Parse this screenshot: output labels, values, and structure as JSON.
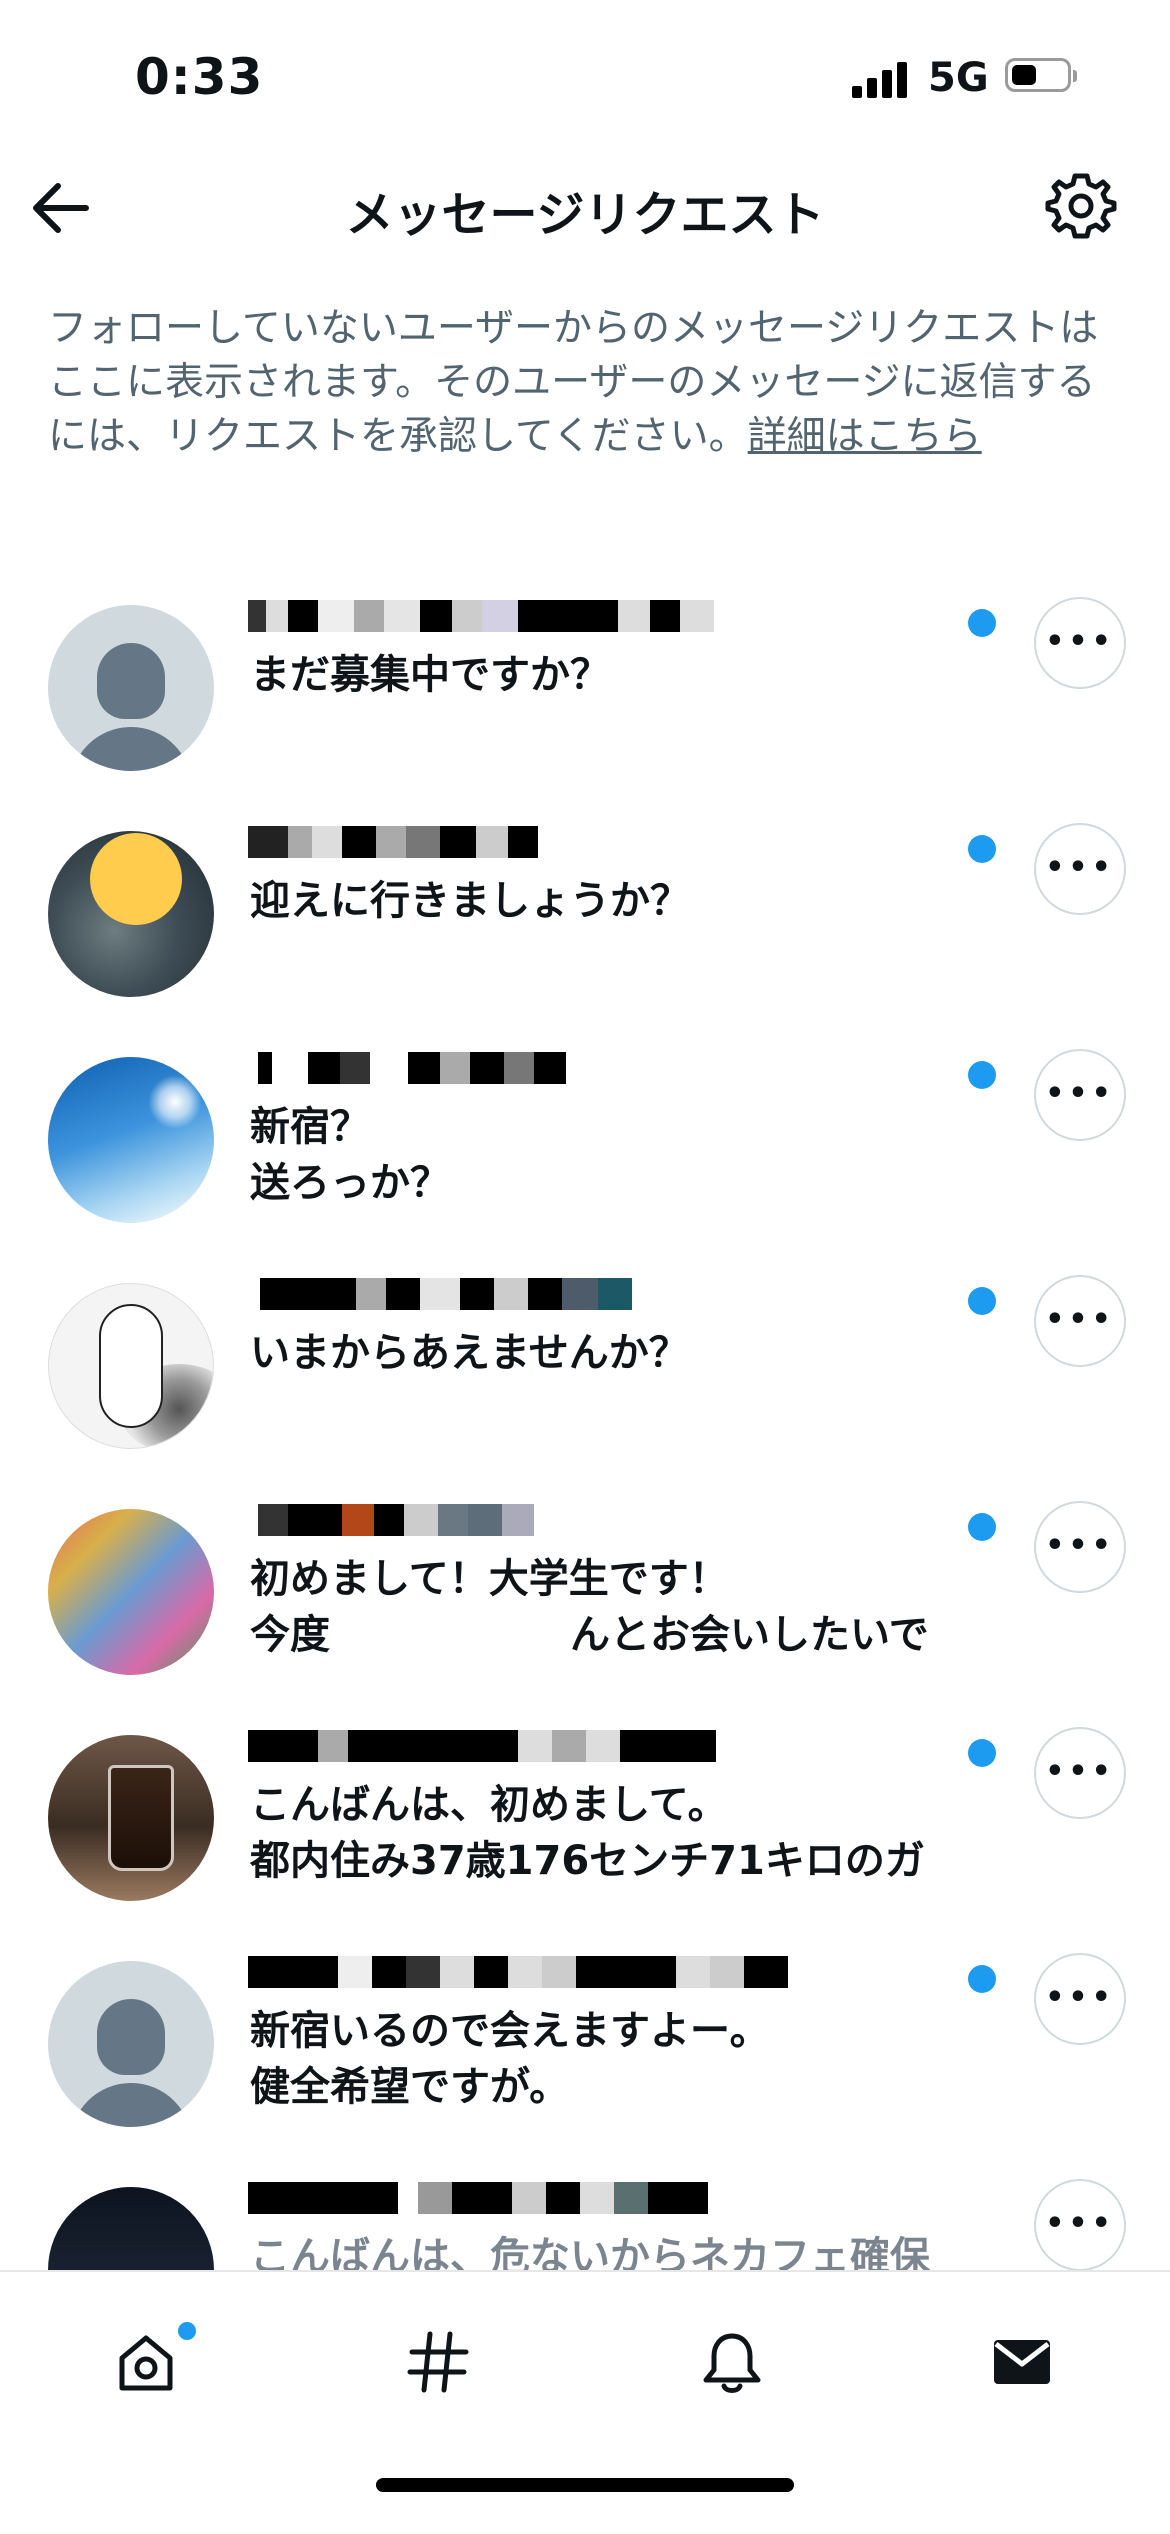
{
  "status_bar": {
    "time": "0:33",
    "network": "5G",
    "battery_level": 0.45
  },
  "header": {
    "title": "メッセージリクエスト"
  },
  "info": {
    "text": "フォローしていないユーザーからのメッセージリクエストはここに表示されます。そのユーザーのメッセージに返信するには、リクエストを承認してください。",
    "link": "詳細はこちら"
  },
  "requests": [
    {
      "avatar": "default-avatar",
      "lines": [
        "まだ募集中ですか？",
        ""
      ],
      "unread": true
    },
    {
      "avatar": "photo-avatar",
      "lines": [
        "迎えに行きましょうか？",
        ""
      ],
      "unread": true
    },
    {
      "avatar": "sky-avatar",
      "lines": [
        "新宿？",
        "送ろっか？"
      ],
      "unread": true
    },
    {
      "avatar": "manga-avatar",
      "lines": [
        "いまからあえませんか？",
        ""
      ],
      "unread": true
    },
    {
      "avatar": "shirt-avatar",
      "lines": [
        "初めまして！大学生です！",
        "今度　　　　　　んとお会いしたいで"
      ],
      "unread": true
    },
    {
      "avatar": "coffee-avatar",
      "lines": [
        "こんばんは、初めまして。",
        "都内住み37歳176センチ71キロのガ"
      ],
      "unread": true
    },
    {
      "avatar": "default-avatar",
      "lines": [
        "新宿いるので会えますよー。",
        "健全希望ですが。"
      ],
      "unread": true
    },
    {
      "avatar": "night-avatar",
      "lines": [
        "こんばんは、危ないからネカフェ確保",
        ""
      ],
      "unread": false
    }
  ],
  "more_label": "•••",
  "nav": {
    "items": [
      "home-icon",
      "explore-icon",
      "notifications-icon",
      "messages-icon"
    ],
    "home_has_badge": true
  },
  "colors": {
    "accent": "#1d9bf0",
    "text": "#0f1419",
    "secondary_text": "#536471"
  }
}
